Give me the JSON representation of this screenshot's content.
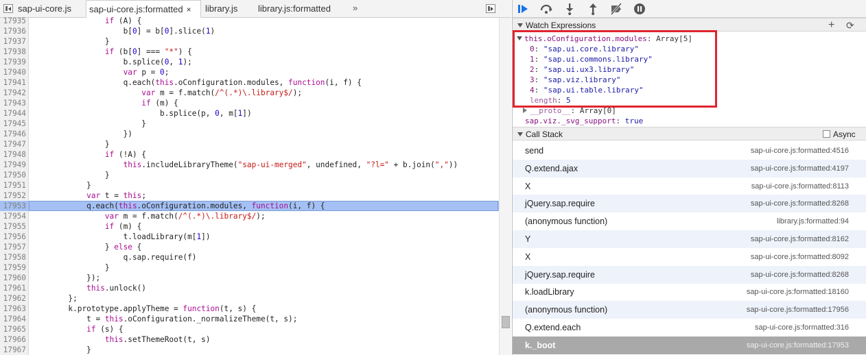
{
  "tabs": [
    {
      "label": "sap-ui-core.js",
      "active": false
    },
    {
      "label": "sap-ui-core.js:formatted",
      "active": true,
      "close": "×"
    },
    {
      "label": "library.js",
      "active": false
    },
    {
      "label": "library.js:formatted",
      "active": false
    }
  ],
  "tabs_more": "»",
  "code_lines": [
    {
      "n": "17935",
      "html": "                <span class=\"kw\">if</span> (A) {"
    },
    {
      "n": "17936",
      "html": "                    b[<span class=\"num\">0</span>] = b[<span class=\"num\">0</span>].slice(<span class=\"num\">1</span>)"
    },
    {
      "n": "17937",
      "html": "                }"
    },
    {
      "n": "17938",
      "html": "                <span class=\"kw\">if</span> (b[<span class=\"num\">0</span>] === <span class=\"str\">\"*\"</span>) {"
    },
    {
      "n": "17939",
      "html": "                    b.splice(<span class=\"num\">0</span>, <span class=\"num\">1</span>);"
    },
    {
      "n": "17940",
      "html": "                    <span class=\"kw\">var</span> p = <span class=\"num\">0</span>;"
    },
    {
      "n": "17941",
      "html": "                    q.each(<span class=\"kw\">this</span>.oConfiguration.modules, <span class=\"kw\">function</span>(i, f) {"
    },
    {
      "n": "17942",
      "html": "                        <span class=\"kw\">var</span> m = f.match(<span class=\"str\">/^(.*)\\.library$/</span>);"
    },
    {
      "n": "17943",
      "html": "                        <span class=\"kw\">if</span> (m) {"
    },
    {
      "n": "17944",
      "html": "                            b.splice(p, <span class=\"num\">0</span>, m[<span class=\"num\">1</span>])"
    },
    {
      "n": "17945",
      "html": "                        }"
    },
    {
      "n": "17946",
      "html": "                    })"
    },
    {
      "n": "17947",
      "html": "                }"
    },
    {
      "n": "17948",
      "html": "                <span class=\"kw\">if</span> (!A) {"
    },
    {
      "n": "17949",
      "html": "                    <span class=\"kw\">this</span>.includeLibraryTheme(<span class=\"str\">\"sap-ui-merged\"</span>, undefined, <span class=\"str\">\"?l=\"</span> + b.join(<span class=\"str\">\",\"</span>))"
    },
    {
      "n": "17950",
      "html": "                }"
    },
    {
      "n": "17951",
      "html": "            }"
    },
    {
      "n": "17952",
      "html": "            <span class=\"kw\">var</span> t = <span class=\"kw\">this</span>;"
    },
    {
      "n": "17953",
      "html": "            q.each(<span class=\"kw\">this</span>.oConfiguration.modules, <span class=\"kw\">function</span>(i, f) {",
      "current": true
    },
    {
      "n": "17954",
      "html": "                <span class=\"kw\">var</span> m = f.match(<span class=\"str\">/^(.*)\\.library$/</span>);"
    },
    {
      "n": "17955",
      "html": "                <span class=\"kw\">if</span> (m) {"
    },
    {
      "n": "17956",
      "html": "                    t.loadLibrary(m[<span class=\"num\">1</span>])"
    },
    {
      "n": "17957",
      "html": "                } <span class=\"kw\">else</span> {"
    },
    {
      "n": "17958",
      "html": "                    q.sap.require(f)"
    },
    {
      "n": "17959",
      "html": "                }"
    },
    {
      "n": "17960",
      "html": "            });"
    },
    {
      "n": "17961",
      "html": "            <span class=\"kw\">this</span>.unlock()"
    },
    {
      "n": "17962",
      "html": "        };"
    },
    {
      "n": "17963",
      "html": "        k.prototype.applyTheme = <span class=\"kw\">function</span>(t, s) {"
    },
    {
      "n": "17964",
      "html": "            t = <span class=\"kw\">this</span>.oConfiguration._normalizeTheme(t, s);"
    },
    {
      "n": "17965",
      "html": "            <span class=\"kw\">if</span> (s) {"
    },
    {
      "n": "17966",
      "html": "                <span class=\"kw\">this</span>.setThemeRoot(t, s)"
    },
    {
      "n": "17967",
      "html": "            }"
    }
  ],
  "debugger_toolbar": [
    "resume-icon",
    "step-over-icon",
    "step-into-icon",
    "step-out-icon",
    "deactivate-breakpoints-icon",
    "pause-on-exceptions-icon"
  ],
  "watch": {
    "title": "Watch Expressions",
    "add": "+",
    "refresh": "⟳",
    "expr_name": "this.oConfiguration.modules",
    "expr_sep": ": ",
    "expr_type": "Array[5]",
    "items": [
      {
        "key": "0",
        "value": "\"sap.ui.core.library\""
      },
      {
        "key": "1",
        "value": "\"sap.ui.commons.library\""
      },
      {
        "key": "2",
        "value": "\"sap.ui.ux3.library\""
      },
      {
        "key": "3",
        "value": "\"sap.viz.library\""
      },
      {
        "key": "4",
        "value": "\"sap.ui.table.library\""
      }
    ],
    "length_key": "length",
    "length_value": "5",
    "proto_key": "__proto__",
    "proto_value": ": Array[0]",
    "expr2_name": "sap.viz._svg_support",
    "expr2_value": "true"
  },
  "callstack": {
    "title": "Call Stack",
    "async_label": "Async",
    "frames": [
      {
        "name": "send",
        "location": "sap-ui-core.js:formatted:4516"
      },
      {
        "name": "Q.extend.ajax",
        "location": "sap-ui-core.js:formatted:4197"
      },
      {
        "name": "X",
        "location": "sap-ui-core.js:formatted:8113"
      },
      {
        "name": "jQuery.sap.require",
        "location": "sap-ui-core.js:formatted:8268"
      },
      {
        "name": "(anonymous function)",
        "location": "library.js:formatted:94"
      },
      {
        "name": "Y",
        "location": "sap-ui-core.js:formatted:8162"
      },
      {
        "name": "X",
        "location": "sap-ui-core.js:formatted:8092"
      },
      {
        "name": "jQuery.sap.require",
        "location": "sap-ui-core.js:formatted:8268"
      },
      {
        "name": "k.loadLibrary",
        "location": "sap-ui-core.js:formatted:18160"
      },
      {
        "name": "(anonymous function)",
        "location": "sap-ui-core.js:formatted:17956"
      },
      {
        "name": "Q.extend.each",
        "location": "sap-ui-core.js:formatted:316"
      },
      {
        "name": "k._boot",
        "location": "sap-ui-core.js:formatted:17953",
        "selected": true
      }
    ]
  },
  "colors": {
    "highlight": "#e0242e",
    "current_line": "#a4c0f4",
    "selected_frame": "#a9a9a9"
  }
}
